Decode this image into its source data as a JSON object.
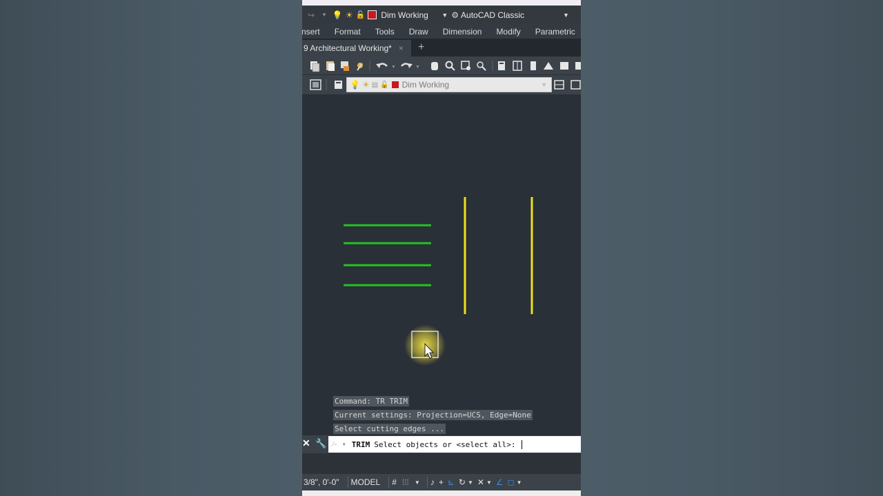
{
  "quick_access": {
    "layer_name": "Dim Working",
    "layer_color": "#c8181e",
    "workspace": "AutoCAD Classic"
  },
  "menu": {
    "items": [
      "nsert",
      "Format",
      "Tools",
      "Draw",
      "Dimension",
      "Modify",
      "Parametric"
    ]
  },
  "tabs": {
    "active_label": "9 Architectural Working*",
    "close_glyph": "×",
    "new_tab_glyph": "+"
  },
  "layer_toolbar": {
    "layer_name": "Dim Working",
    "layer_color": "#c8181e"
  },
  "drawing": {
    "horizontal_line_color": "#22c322",
    "vertical_line_color": "#f2e01a"
  },
  "command_history": [
    "Command: TR TRIM",
    "Current settings: Projection=UCS, Edge=None",
    "Select cutting edges ..."
  ],
  "command_line": {
    "command": "TRIM",
    "prompt": "Select objects or <select all>:"
  },
  "status_bar": {
    "coordinates": "3/8\", 0'-0\"",
    "space": "MODEL"
  },
  "colors": {
    "canvas_bg": "#293037",
    "cursor_highlight": "#e8dc40"
  }
}
